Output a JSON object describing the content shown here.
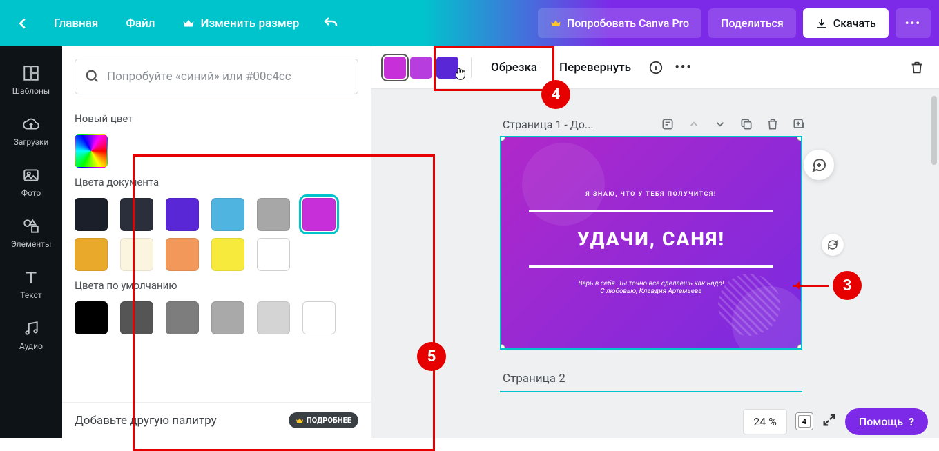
{
  "header": {
    "home": "Главная",
    "file": "Файл",
    "resize": "Изменить размер",
    "try_pro": "Попробовать Canva Pro",
    "share": "Поделиться",
    "download": "Скачать"
  },
  "sidebar": {
    "templates": "Шаблоны",
    "uploads": "Загрузки",
    "photos": "Фото",
    "elements": "Элементы",
    "text": "Текст",
    "audio": "Аудио"
  },
  "panel": {
    "search_placeholder": "Попробуйте «синий» или #00c4cc",
    "new_color": "Новый цвет",
    "doc_colors": "Цвета документа",
    "default_colors": "Цвета по умолчанию",
    "add_palette": "Добавьте другую палитру",
    "learn_more": "ПОДРОБНЕЕ",
    "doc_swatches_row1": [
      "#1a1f29",
      "#2a2f3b",
      "#5a27d6",
      "#4fb4e0",
      "#a7a7a7",
      "#c730d8"
    ],
    "doc_swatches_row2": [
      "#e9a92b",
      "#fbf4de",
      "#f2985a",
      "#f7ea3c",
      "#ffffff"
    ],
    "default_swatches": [
      "#000000",
      "#555555",
      "#7d7d7d",
      "#a9a9a9",
      "#d4d4d4",
      "#ffffff"
    ]
  },
  "context": {
    "swatches": [
      "#c730d8",
      "#b83ddf",
      "#5a27d6"
    ],
    "crop": "Обрезка",
    "flip": "Перевернуть"
  },
  "canvas": {
    "page1_title": "Страница 1 - До...",
    "page2_title": "Страница 2",
    "design": {
      "topline": "Я ЗНАЮ, ЧТО У ТЕБЯ ПОЛУЧИТСЯ!",
      "main": "УДАЧИ, САНЯ!",
      "sub1": "Верь в себя. Ты точно все сделаешь как надо!",
      "sub2": "С любовью, Клавдия Артемьева"
    }
  },
  "bottom": {
    "zoom": "24 %",
    "page_count": "4",
    "help": "Помощь"
  },
  "annotations": {
    "n3": "3",
    "n4": "4",
    "n5": "5"
  }
}
